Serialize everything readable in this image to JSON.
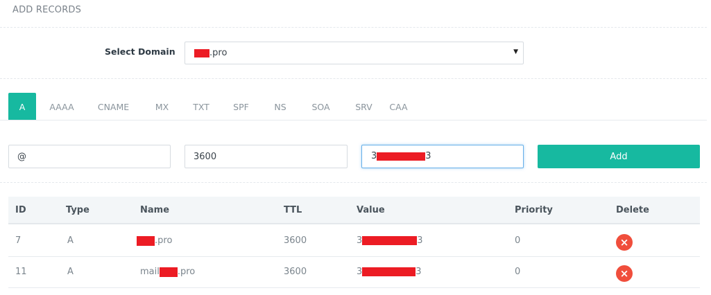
{
  "panel": {
    "title": "ADD RECORDS"
  },
  "domain": {
    "label": "Select Domain",
    "suffix": ".pro"
  },
  "tabs": [
    "A",
    "AAAA",
    "CNAME",
    "MX",
    "TXT",
    "SPF",
    "NS",
    "SOA",
    "SRV",
    "CAA"
  ],
  "form": {
    "name_value": "@",
    "ttl_value": "3600",
    "value_prefix": "3",
    "value_suffix": "3",
    "add_label": "Add"
  },
  "table": {
    "headers": [
      "ID",
      "Type",
      "Name",
      "TTL",
      "Value",
      "Priority",
      "Delete"
    ],
    "rows": [
      {
        "id": "7",
        "type": "A",
        "name_prefix": "",
        "name_suffix": ".pro",
        "ttl": "3600",
        "value_prefix": "3",
        "value_suffix": "3",
        "priority": "0"
      },
      {
        "id": "11",
        "type": "A",
        "name_prefix": "mail",
        "name_suffix": ".pro",
        "ttl": "3600",
        "value_prefix": "3",
        "value_suffix": "3",
        "priority": "0"
      }
    ]
  },
  "colors": {
    "accent": "#17b9a0",
    "delete": "#f04e3c",
    "redaction": "#ec1c24"
  },
  "icons": {
    "delete": "close-circle-icon",
    "select_caret": "caret-down-icon"
  }
}
